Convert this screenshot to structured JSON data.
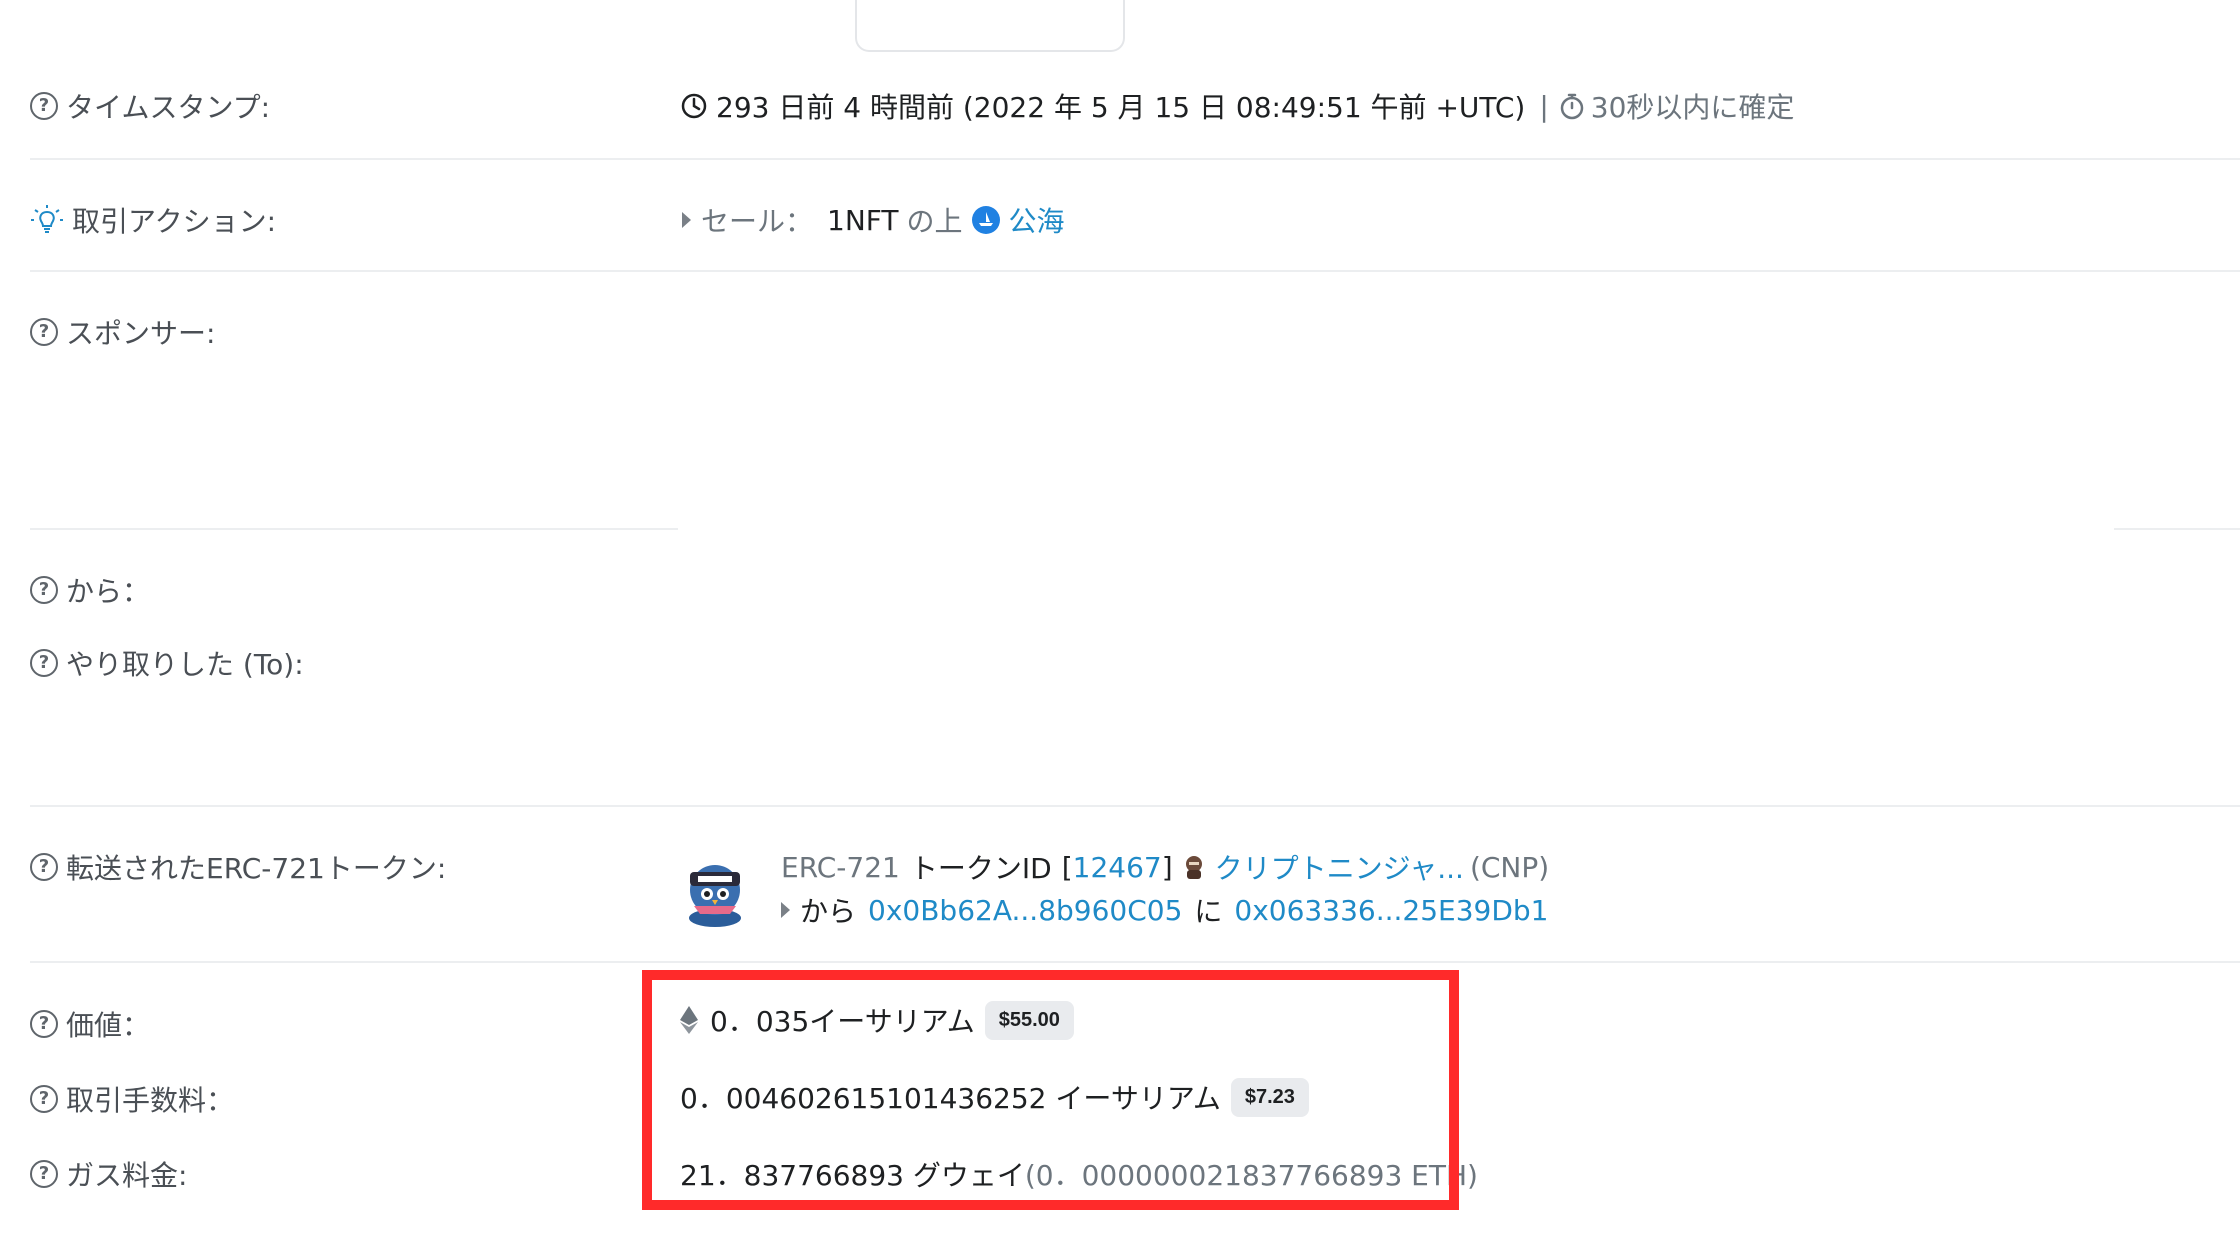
{
  "rows": {
    "timestamp": {
      "label": "タイムスタンプ:",
      "value": "293 日前 4 時間前 (2022 年 5 月 15 日 08:49:51 午前 +UTC)",
      "sep": "|",
      "confirm": "30秒以内に確定"
    },
    "action": {
      "label": "取引アクション:",
      "prefix": "セール：",
      "amount": "1NFT",
      "mid": "の上",
      "market": "公海"
    },
    "sponsor": {
      "label": "スポンサー:"
    },
    "from": {
      "label": "から："
    },
    "to": {
      "label": "やり取りした (To):"
    },
    "erc721": {
      "label": "転送されたERC-721トークン:",
      "standard": "ERC-721",
      "token_id_label": "トークンID",
      "bracket_open": "[",
      "token_id": "12467",
      "bracket_close": "]",
      "collection": "クリプトニンジャ...",
      "symbol": "(CNP)",
      "from_word": "から",
      "from_addr": "0x0Bb62A...8b960C05",
      "to_word": "に",
      "to_addr": "0x063336...25E39Db1"
    },
    "value": {
      "label": "価値：",
      "amount": "0．035イーサリアム",
      "usd": "$55.00"
    },
    "fee": {
      "label": "取引手数料：",
      "amount": "0．004602615101436252 イーサリアム",
      "usd": "$7.23"
    },
    "gas": {
      "label": "ガス料金:",
      "gwei": "21．837766893 グウェイ",
      "eth": "(0．000000021837766893 ETH)"
    }
  },
  "icons": {
    "help": "question-circle-icon",
    "bulb": "lightbulb-icon",
    "clock": "clock-icon",
    "stopwatch": "stopwatch-icon",
    "opensea": "opensea-icon",
    "eth": "ethereum-icon",
    "ninja": "ninja-avatar"
  },
  "colors": {
    "link": "#1f8ac7",
    "highlight": "#ff2a2a",
    "opensea": "#2081e2"
  }
}
